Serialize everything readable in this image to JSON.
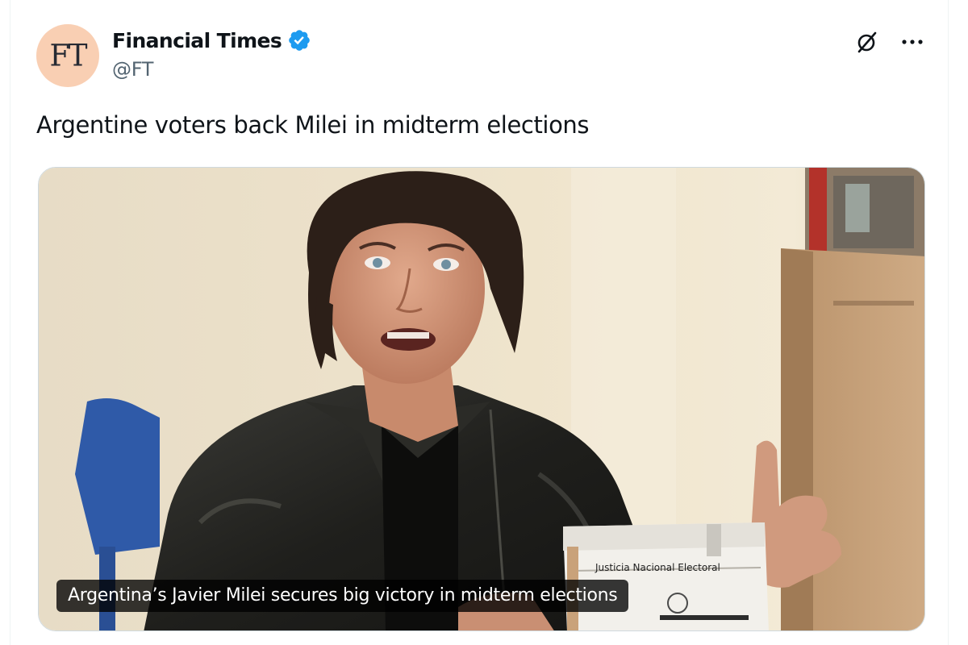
{
  "post": {
    "author": {
      "avatar_text": "FT",
      "display_name": "Financial Times",
      "handle": "@FT",
      "verified": true
    },
    "text": "Argentine voters back Milei in midterm elections",
    "media": {
      "caption": "Argentina’s Javier Milei secures big victory in midterm elections",
      "ballot_box_label": "Justicia Nacional Electoral"
    }
  },
  "icons": {
    "verified": "verified-badge-icon",
    "grok": "grok-icon",
    "more": "more-options-icon"
  },
  "colors": {
    "verified_blue": "#1d9bf0",
    "avatar_bg": "#f9cfb3",
    "text_primary": "#0f1419",
    "text_secondary": "#536471"
  }
}
